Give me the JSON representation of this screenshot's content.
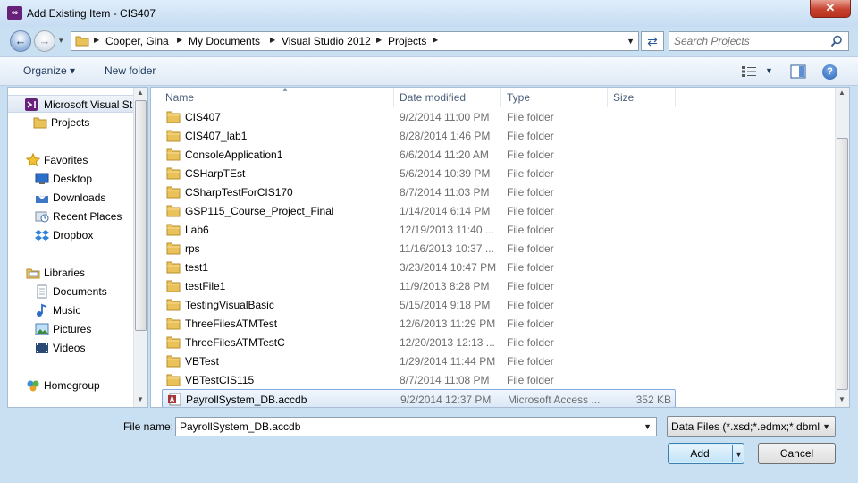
{
  "window": {
    "title": "Add Existing Item - CIS407",
    "close_glyph": "✕",
    "app_icon": "visual-studio-icon"
  },
  "address": {
    "crumbs": [
      "Cooper, Gina",
      "My Documents",
      "Visual Studio 2012",
      "Projects"
    ],
    "search_placeholder": "Search Projects"
  },
  "toolbar": {
    "organize": "Organize ▾",
    "new_folder": "New folder",
    "help_glyph": "?"
  },
  "nav": {
    "items": [
      {
        "label": "Microsoft Visual St",
        "icon": "visual-studio-icon"
      },
      {
        "label": "Projects",
        "icon": "folder-icon"
      },
      {
        "label": "Favorites",
        "icon": "star-icon"
      },
      {
        "label": "Desktop",
        "icon": "desktop-icon"
      },
      {
        "label": "Downloads",
        "icon": "downloads-icon"
      },
      {
        "label": "Recent Places",
        "icon": "recent-places-icon"
      },
      {
        "label": "Dropbox",
        "icon": "dropbox-icon"
      },
      {
        "label": "Libraries",
        "icon": "libraries-icon"
      },
      {
        "label": "Documents",
        "icon": "documents-icon"
      },
      {
        "label": "Music",
        "icon": "music-icon"
      },
      {
        "label": "Pictures",
        "icon": "pictures-icon"
      },
      {
        "label": "Videos",
        "icon": "videos-icon"
      },
      {
        "label": "Homegroup",
        "icon": "homegroup-icon"
      }
    ]
  },
  "columns": {
    "name": "Name",
    "date": "Date modified",
    "type": "Type",
    "size": "Size"
  },
  "files": [
    {
      "name": "CIS407",
      "date": "9/2/2014 11:00 PM",
      "type": "File folder",
      "size": ""
    },
    {
      "name": "CIS407_lab1",
      "date": "8/28/2014 1:46 PM",
      "type": "File folder",
      "size": ""
    },
    {
      "name": "ConsoleApplication1",
      "date": "6/6/2014 11:20 AM",
      "type": "File folder",
      "size": ""
    },
    {
      "name": "CSHarpTEst",
      "date": "5/6/2014 10:39 PM",
      "type": "File folder",
      "size": ""
    },
    {
      "name": "CSharpTestForCIS170",
      "date": "8/7/2014 11:03 PM",
      "type": "File folder",
      "size": ""
    },
    {
      "name": "GSP115_Course_Project_Final",
      "date": "1/14/2014 6:14 PM",
      "type": "File folder",
      "size": ""
    },
    {
      "name": "Lab6",
      "date": "12/19/2013 11:40 ...",
      "type": "File folder",
      "size": ""
    },
    {
      "name": "rps",
      "date": "11/16/2013 10:37 ...",
      "type": "File folder",
      "size": ""
    },
    {
      "name": "test1",
      "date": "3/23/2014 10:47 PM",
      "type": "File folder",
      "size": ""
    },
    {
      "name": "testFile1",
      "date": "11/9/2013 8:28 PM",
      "type": "File folder",
      "size": ""
    },
    {
      "name": "TestingVisualBasic",
      "date": "5/15/2014 9:18 PM",
      "type": "File folder",
      "size": ""
    },
    {
      "name": "ThreeFilesATMTest",
      "date": "12/6/2013 11:29 PM",
      "type": "File folder",
      "size": ""
    },
    {
      "name": "ThreeFilesATMTestC",
      "date": "12/20/2013 12:13 ...",
      "type": "File folder",
      "size": ""
    },
    {
      "name": "VBTest",
      "date": "1/29/2014 11:44 PM",
      "type": "File folder",
      "size": ""
    },
    {
      "name": "VBTestCIS115",
      "date": "8/7/2014 11:08 PM",
      "type": "File folder",
      "size": ""
    },
    {
      "name": "PayrollSystem_DB.accdb",
      "date": "9/2/2014 12:37 PM",
      "type": "Microsoft Access ...",
      "size": "352 KB",
      "selected": true
    }
  ],
  "bottom": {
    "file_name_label": "File name:",
    "file_name_value": "PayrollSystem_DB.accdb",
    "filter": "Data Files (*.xsd;*.edmx;*.dbml;",
    "add": "Add",
    "cancel": "Cancel"
  },
  "colors": {
    "folder": "#e9c25a",
    "selection_border": "#84acdd",
    "access_red": "#a4373a"
  }
}
